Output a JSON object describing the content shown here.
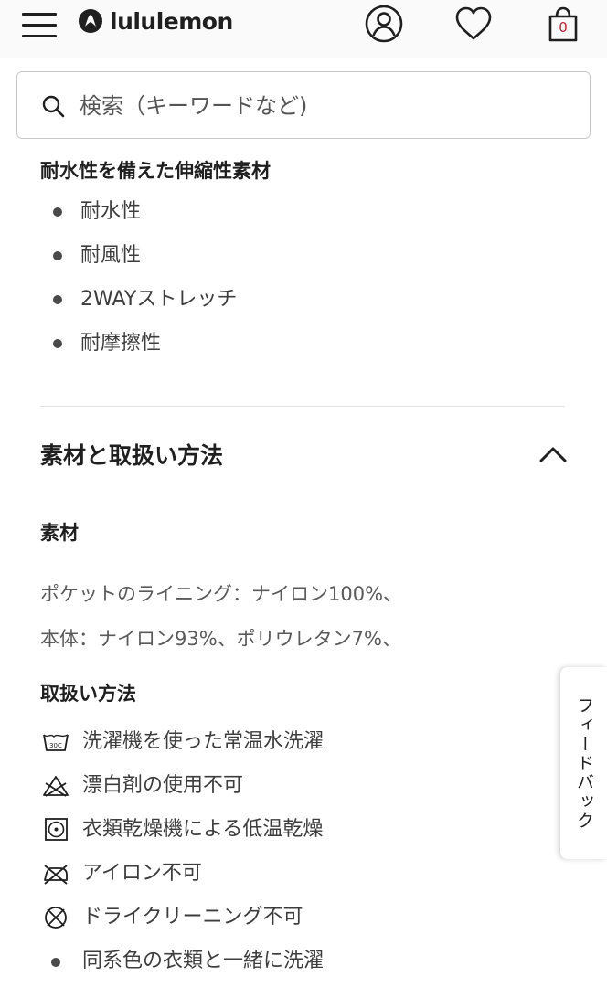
{
  "header": {
    "brand": "lululemon",
    "bag_count": "0",
    "icons": [
      "menu-icon",
      "lululemon-logo-icon",
      "account-icon",
      "heart-icon",
      "bag-icon"
    ]
  },
  "search": {
    "placeholder": "検索（キーワードなど)"
  },
  "features": {
    "heading": "耐水性を備えた伸縮性素材",
    "items": [
      "耐水性",
      "耐風性",
      "2WAYストレッチ",
      "耐摩擦性"
    ]
  },
  "materials_care": {
    "title": "素材と取扱い方法",
    "expanded": true,
    "material_label": "素材",
    "material_lines": [
      "ポケットのライニング：ナイロン100%、",
      "本体：ナイロン93%、ポリウレタン7%、"
    ],
    "care_label": "取扱い方法",
    "care_items": [
      {
        "icon": "wash-30c-icon",
        "wash_temp": "30C",
        "text": "洗濯機を使った常温水洗濯"
      },
      {
        "icon": "no-bleach-icon",
        "text": "漂白剤の使用不可"
      },
      {
        "icon": "tumble-dry-low-icon",
        "text": "衣類乾燥機による低温乾燥"
      },
      {
        "icon": "no-iron-icon",
        "text": "アイロン不可"
      },
      {
        "icon": "no-dry-clean-icon",
        "text": "ドライクリーニング不可"
      },
      {
        "icon": "bullet",
        "text": "同系色の衣類と一緒に洗濯"
      }
    ]
  },
  "feedback": {
    "label": "フィードバック"
  },
  "colors": {
    "text": "#1f1f1f",
    "muted_text": "#5a5a5a",
    "bag_count": "#d31e2c",
    "header_bg": "#fafafa"
  }
}
